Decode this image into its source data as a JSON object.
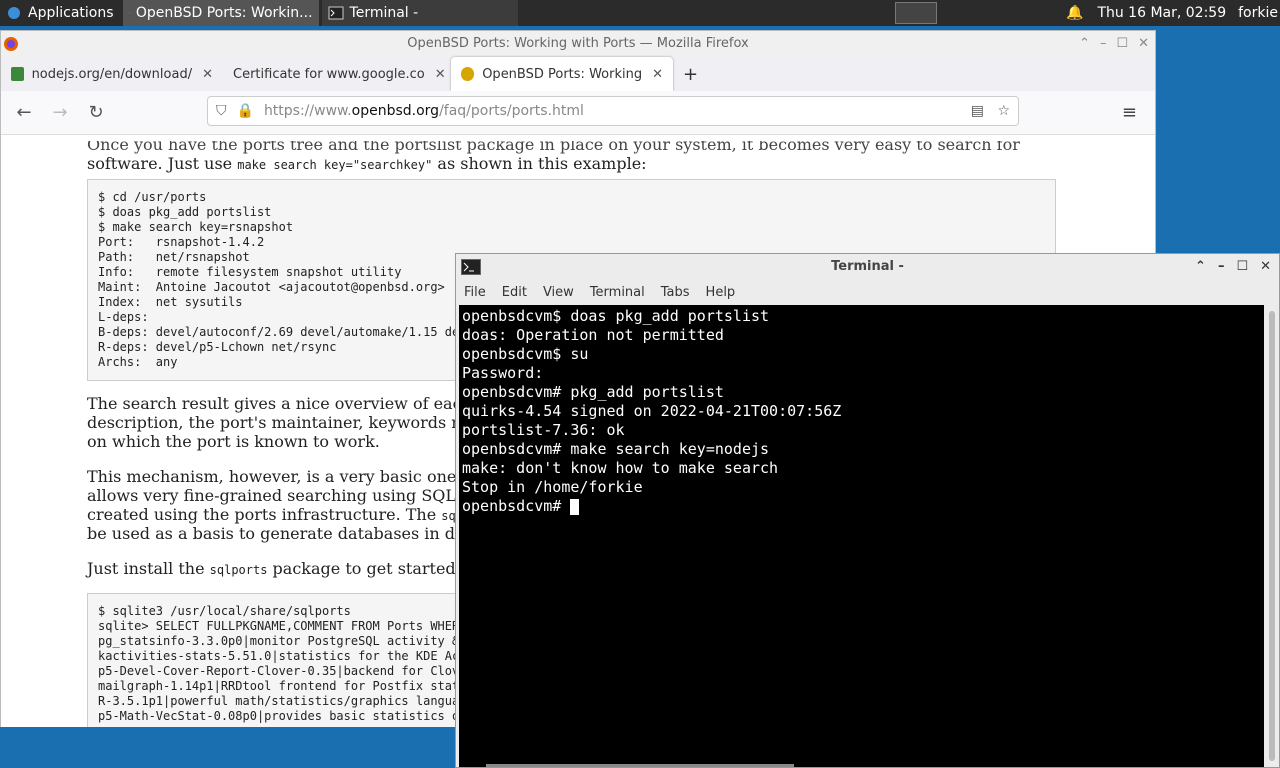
{
  "panel": {
    "applications": "Applications",
    "tasks": [
      {
        "label": "OpenBSD Ports: Workin..."
      },
      {
        "label": "Terminal -"
      }
    ],
    "clock": "Thu 16 Mar, 02:59",
    "user": "forkie"
  },
  "firefox": {
    "window_title": "OpenBSD Ports: Working with Ports — Mozilla Firefox",
    "tabs": [
      {
        "label": "nodejs.org/en/download/"
      },
      {
        "label": "Certificate for www.google.co"
      },
      {
        "label": "OpenBSD Ports: Working"
      }
    ],
    "url_prefix": "https://www.",
    "url_host": "openbsd.org",
    "url_path": "/faq/ports/ports.html",
    "page": {
      "p1_line1": "Once you have the ports tree and the portslist package in place on your system, it becomes very easy to search for",
      "p1_line2a": "software. Just use ",
      "p1_code": "make search key=\"searchkey\"",
      "p1_line2b": " as shown in this example:",
      "code1": "$ cd /usr/ports\n$ doas pkg_add portslist\n$ make search key=rsnapshot\nPort:   rsnapshot-1.4.2\nPath:   net/rsnapshot\nInfo:   remote filesystem snapshot utility\nMaint:  Antoine Jacoutot <ajacoutot@openbsd.org>\nIndex:  net sysutils\nL-deps:\nB-deps: devel/autoconf/2.69 devel/automake/1.15 dev\nR-deps: devel/p5-Lchown net/rsync\nArchs:  any",
      "p2_l1": "The search result gives a nice overview of eac",
      "p2_l2": "description, the port's maintainer, keywords r",
      "p2_l3": "on which the port is known to work.",
      "p3_l1": "This mechanism, however, is a very basic one,",
      "p3_l2": "allows very fine-grained searching using SQL,",
      "p3_l3a": "created using the ports infrastructure. The ",
      "p3_l3code": "sql",
      "p3_l4": "be used as a basis to generate databases in di",
      "p4a": "Just install the ",
      "p4code": "sqlports",
      "p4b": " package to get started.",
      "code2": "$ sqlite3 /usr/local/share/sqlports\nsqlite> SELECT FULLPKGNAME,COMMENT FROM Ports WHERE\npg_statsinfo-3.3.0p0|monitor PostgreSQL activity &\nkactivities-stats-5.51.0|statistics for the KDE Act\np5-Devel-Cover-Report-Clover-0.35|backend for Clove\nmailgraph-1.14p1|RRDtool frontend for Postfix stati\nR-3.5.1p1|powerful math/statistics/graphics languag\np5-Math-VecStat-0.08p0|provides basic statistics on"
    }
  },
  "terminal": {
    "title": "Terminal -",
    "menu": [
      "File",
      "Edit",
      "View",
      "Terminal",
      "Tabs",
      "Help"
    ],
    "lines": [
      "openbsdcvm$ doas pkg_add portslist",
      "doas: Operation not permitted",
      "openbsdcvm$ su",
      "Password:",
      "openbsdcvm# pkg_add portslist",
      "quirks-4.54 signed on 2022-04-21T00:07:56Z",
      "portslist-7.36: ok",
      "openbsdcvm# make search key=nodejs",
      "make: don't know how to make search",
      "Stop in /home/forkie"
    ],
    "prompt": "openbsdcvm# "
  }
}
